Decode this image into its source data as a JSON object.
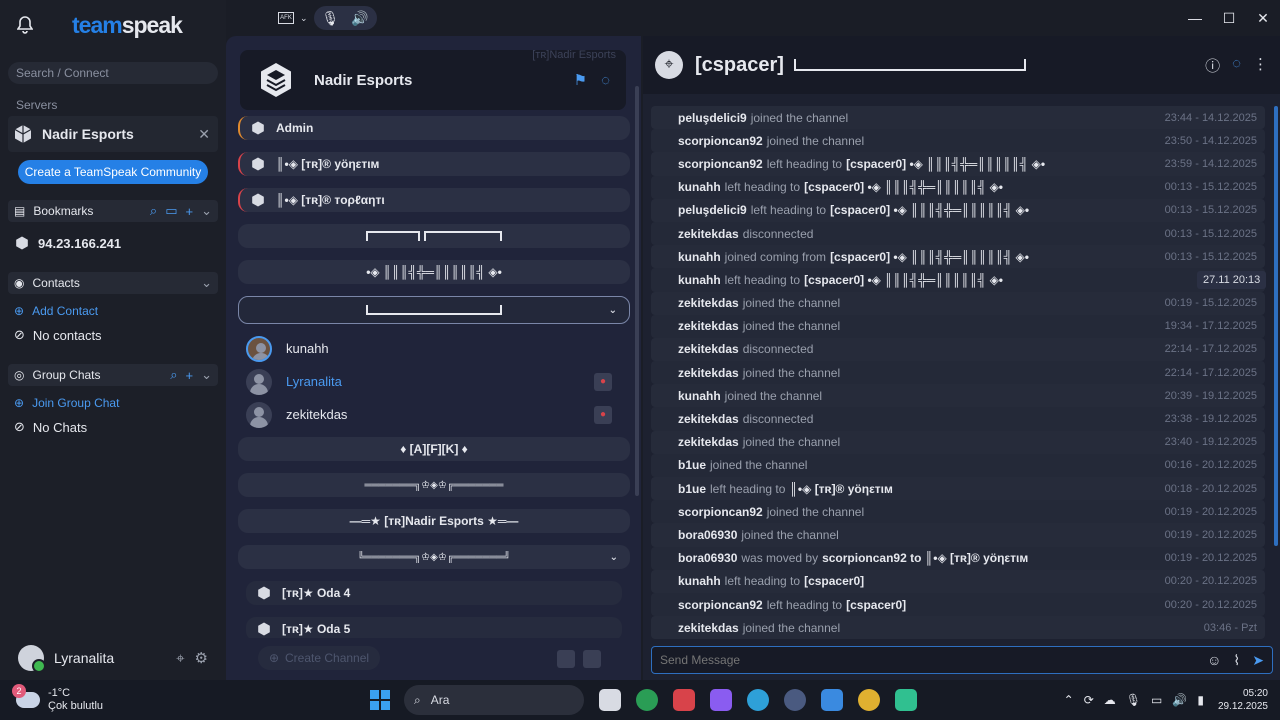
{
  "app": {
    "logo_a": "team",
    "logo_b": "speak"
  },
  "sidebar": {
    "search_placeholder": "Search / Connect",
    "servers_label": "Servers",
    "server_name": "Nadir Esports",
    "create_community": "Create a TeamSpeak Community",
    "bookmarks_label": "Bookmarks",
    "bookmark_ip": "94.23.166.241",
    "contacts_label": "Contacts",
    "add_contact": "Add Contact",
    "no_contacts": "No contacts",
    "group_chats_label": "Group Chats",
    "join_group_chat": "Join Group Chat",
    "no_chats": "No Chats",
    "user_name": "Lyranalita"
  },
  "audio": {
    "afk": "AFK"
  },
  "server": {
    "name": "Nadir Esports",
    "ghost": "[ᴛʀ]Nadir Esports",
    "create_channel": "Create Channel"
  },
  "channels": {
    "admin": "Admin",
    "yonetim": "║•◈ [ᴛʀ]® yöηεтιм",
    "toplanti": "║•◈ [ᴛʀ]® тoρℓαηтι",
    "deco1": "•◈ ║║║╣╬═║║║║║╣ ◈•",
    "afk": "♦ [A][F][K] ♦",
    "deco2": "═══════╗♔◈♔╔═══════",
    "nadir": "—═★ [ᴛʀ]Nadir Esports ★═—",
    "deco3": "╚═══════╗♔◈♔╔═══════╝",
    "oda4": "[ᴛʀ]★ Oda 4",
    "oda5": "[ᴛʀ]★ Oda 5"
  },
  "channel_users": [
    {
      "name": "kunahh"
    },
    {
      "name": "Lyranalita"
    },
    {
      "name": "zekitekdas"
    }
  ],
  "chat": {
    "channel": "[cspacer]",
    "tooltip": "27.11 20:13",
    "input_placeholder": "Send Message",
    "messages": [
      {
        "who": "peluşdelici9",
        "txt": "joined the channel",
        "tgt": "",
        "time": "23:44 - 14.12.2025"
      },
      {
        "who": "scorpioncan92",
        "txt": "joined the channel",
        "tgt": "",
        "time": "23:50 - 14.12.2025"
      },
      {
        "who": "scorpioncan92",
        "txt": "left heading to",
        "tgt": "[cspacer0] •◈ ║║║╣╬═║║║║║╣ ◈•",
        "time": "23:59 - 14.12.2025"
      },
      {
        "who": "kunahh",
        "txt": "left heading to",
        "tgt": "[cspacer0] •◈ ║║║╣╬═║║║║║╣ ◈•",
        "time": "00:13 - 15.12.2025"
      },
      {
        "who": "peluşdelici9",
        "txt": "left heading to",
        "tgt": "[cspacer0] •◈ ║║║╣╬═║║║║║╣ ◈•",
        "time": "00:13 - 15.12.2025"
      },
      {
        "who": "zekitekdas",
        "txt": "disconnected",
        "tgt": "",
        "time": "00:13 - 15.12.2025"
      },
      {
        "who": "kunahh",
        "txt": "joined coming from",
        "tgt": "[cspacer0] •◈ ║║║╣╬═║║║║║╣ ◈•",
        "time": "00:13 - 15.12.2025"
      },
      {
        "who": "kunahh",
        "txt": "left heading to",
        "tgt": "[cspacer0] •◈ ║║║╣╬═║║║║║╣ ◈•",
        "time": "00:19"
      },
      {
        "who": "zekitekdas",
        "txt": "joined the channel",
        "tgt": "",
        "time": "00:19 - 15.12.2025"
      },
      {
        "who": "zekitekdas",
        "txt": "joined the channel",
        "tgt": "",
        "time": "19:34 - 17.12.2025"
      },
      {
        "who": "zekitekdas",
        "txt": "disconnected",
        "tgt": "",
        "time": "22:14 - 17.12.2025"
      },
      {
        "who": "zekitekdas",
        "txt": "joined the channel",
        "tgt": "",
        "time": "22:14 - 17.12.2025"
      },
      {
        "who": "kunahh",
        "txt": "joined the channel",
        "tgt": "",
        "time": "20:39 - 19.12.2025"
      },
      {
        "who": "zekitekdas",
        "txt": "disconnected",
        "tgt": "",
        "time": "23:38 - 19.12.2025"
      },
      {
        "who": "zekitekdas",
        "txt": "joined the channel",
        "tgt": "",
        "time": "23:40 - 19.12.2025"
      },
      {
        "who": "b1ue",
        "txt": "joined the channel",
        "tgt": "",
        "time": "00:16 - 20.12.2025"
      },
      {
        "who": "b1ue",
        "txt": "left heading to",
        "tgt": "║•◈ [ᴛʀ]® yöηεтιм",
        "time": "00:18 - 20.12.2025"
      },
      {
        "who": "scorpioncan92",
        "txt": "joined the channel",
        "tgt": "",
        "time": "00:19 - 20.12.2025"
      },
      {
        "who": "bora06930",
        "txt": "joined the channel",
        "tgt": "",
        "time": "00:19 - 20.12.2025"
      },
      {
        "who": "bora06930",
        "txt": "was moved by",
        "tgt": "scorpioncan92 to ║•◈ [ᴛʀ]® yöηεтιм",
        "time": "00:19 - 20.12.2025"
      },
      {
        "who": "kunahh",
        "txt": "left heading to",
        "tgt": "[cspacer0]",
        "time": "00:20 - 20.12.2025"
      },
      {
        "who": "scorpioncan92",
        "txt": "left heading to",
        "tgt": "[cspacer0]",
        "time": "00:20 - 20.12.2025"
      },
      {
        "who": "zekitekdas",
        "txt": "joined the channel",
        "tgt": "",
        "time": "03:46 - Pzt"
      }
    ]
  },
  "taskbar": {
    "temp": "-1°C",
    "weather": "Çok bulutlu",
    "badge": "2",
    "search": "Ara",
    "time": "05:20",
    "date": "29.12.2025"
  },
  "colors": {
    "accent": "#2580e6",
    "bg": "#1a1d26"
  }
}
